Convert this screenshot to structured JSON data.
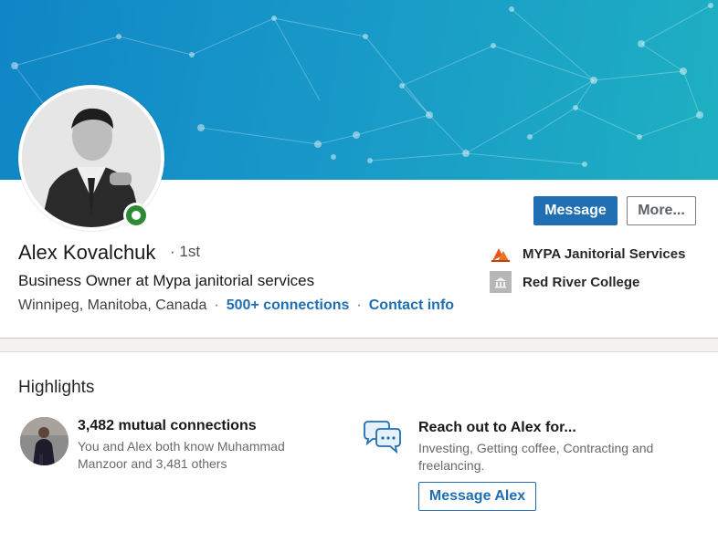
{
  "profile": {
    "name": "Alex Kovalchuk",
    "degree_separator": "·",
    "degree": "1st",
    "headline": "Business Owner at Mypa janitorial services",
    "location": "Winnipeg, Manitoba, Canada",
    "connections": "500+ connections",
    "contact_info": "Contact info",
    "online": true
  },
  "actions": {
    "message_label": "Message",
    "more_label": "More..."
  },
  "organizations": [
    {
      "name": "MYPA Janitorial Services",
      "logo": "mypa-logo-icon"
    },
    {
      "name": "Red River College",
      "logo": "school-building-icon"
    }
  ],
  "highlights": {
    "title": "Highlights",
    "mutual": {
      "title": "3,482 mutual connections",
      "description": "You and Alex both know Muhammad Manzoor and 3,481 others"
    },
    "reach_out": {
      "title": "Reach out to Alex for...",
      "description": "Investing, Getting coffee, Contracting and freelancing.",
      "button_label": "Message Alex"
    }
  },
  "colors": {
    "accent": "#1f6fb2",
    "online": "#2f8a35",
    "banner_start": "#0f86c6",
    "banner_end": "#1eb0c2"
  }
}
